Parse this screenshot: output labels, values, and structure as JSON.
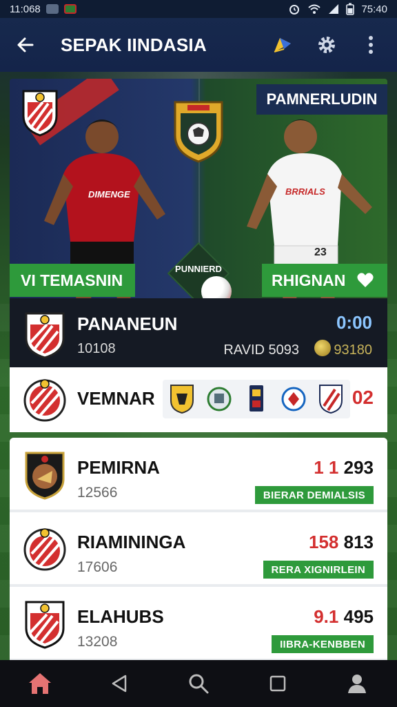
{
  "status_bar": {
    "left_time": "11:068",
    "right_time": "75:40"
  },
  "app_bar": {
    "title": "SEPAK IINDASIA"
  },
  "hero": {
    "top_right_title": "PAMNERLUDIN",
    "diamond_label": "PUNNIERD",
    "left_name": "VI TEMASNIN",
    "right_name": "RHIGNAN",
    "left_jersey_text": "DIMENGE",
    "right_jersey_text": "BRRIALS",
    "right_jersey_number": "23"
  },
  "live_match": {
    "team": "PANANEUN",
    "sub": "10108",
    "clock": "0:00",
    "round": "RAVID 5093",
    "points": "93180"
  },
  "league": {
    "name": "VEMNAR",
    "number": "02"
  },
  "list": [
    {
      "name": "PEMIRNA",
      "meta": "12566",
      "score_red": "1 1",
      "score_black": "293",
      "tag": "BIERAR DEMIALSIS"
    },
    {
      "name": "RIAMININGA",
      "meta": "17606",
      "score_red": "158",
      "score_black": "813",
      "tag": "RERA XIGNIRLEIN"
    },
    {
      "name": "ELAHUBS",
      "meta": "13208",
      "score_red": "9.1",
      "score_black": "495",
      "tag": "IIBRA-KENBBEN"
    }
  ],
  "colors": {
    "accent_green": "#2e9a3b",
    "app_bar": "#17294d",
    "score_red": "#d32f2f",
    "clock_blue": "#8cc6ff"
  },
  "icons": {
    "back": "arrow-left-icon",
    "share": "share-icon",
    "settings": "gear-icon",
    "more": "more-vertical-icon",
    "nav": [
      "home-icon",
      "back-triangle-icon",
      "search-icon",
      "square-icon",
      "profile-icon"
    ]
  }
}
